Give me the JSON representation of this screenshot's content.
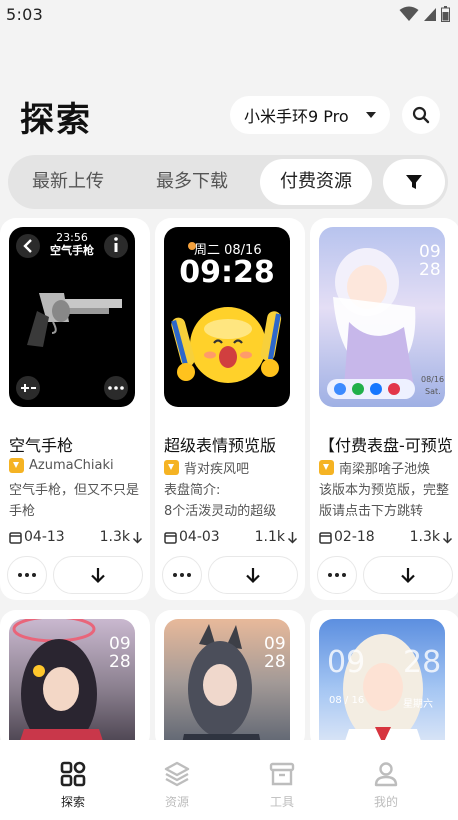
{
  "status": {
    "time": "5:03"
  },
  "header": {
    "title": "探索",
    "device": "小米手环9 Pro"
  },
  "tabs": [
    {
      "label": "最新上传",
      "active": false
    },
    {
      "label": "最多下载",
      "active": false
    },
    {
      "label": "付费资源",
      "active": true
    }
  ],
  "cards": [
    {
      "title": "空气手枪",
      "author": "AzumaChiaki",
      "desc": "空气手枪，但又不只是手枪",
      "date": "04-13",
      "downloads": "1.3k",
      "watch": {
        "time": "23:56",
        "subtitle": "空气手枪"
      }
    },
    {
      "title": "超级表情预览版",
      "author": "背对疾风吧",
      "desc": "表盘简介:\n8个活泼灵动的超级",
      "date": "04-03",
      "downloads": "1.1k",
      "watch": {
        "date": "周二 08/16",
        "time": "09:28"
      }
    },
    {
      "title": "【付费表盘-可预览",
      "author": "南梁那啥子池焕",
      "desc": "该版本为预览版，完整版请点击下方跳转",
      "date": "02-18",
      "downloads": "1.3k",
      "watch": {
        "hour": "09",
        "minute": "28",
        "date": "08/16",
        "day": "Sat."
      }
    }
  ],
  "row2": [
    {
      "hour": "09",
      "minute": "28"
    },
    {
      "hour": "09",
      "minute": "28"
    },
    {
      "hour": "09",
      "minute": "28",
      "date": "08 / 16",
      "day": "星期六"
    }
  ],
  "nav": [
    {
      "label": "探索",
      "active": true
    },
    {
      "label": "资源",
      "active": false
    },
    {
      "label": "工具",
      "active": false
    },
    {
      "label": "我的",
      "active": false
    }
  ]
}
